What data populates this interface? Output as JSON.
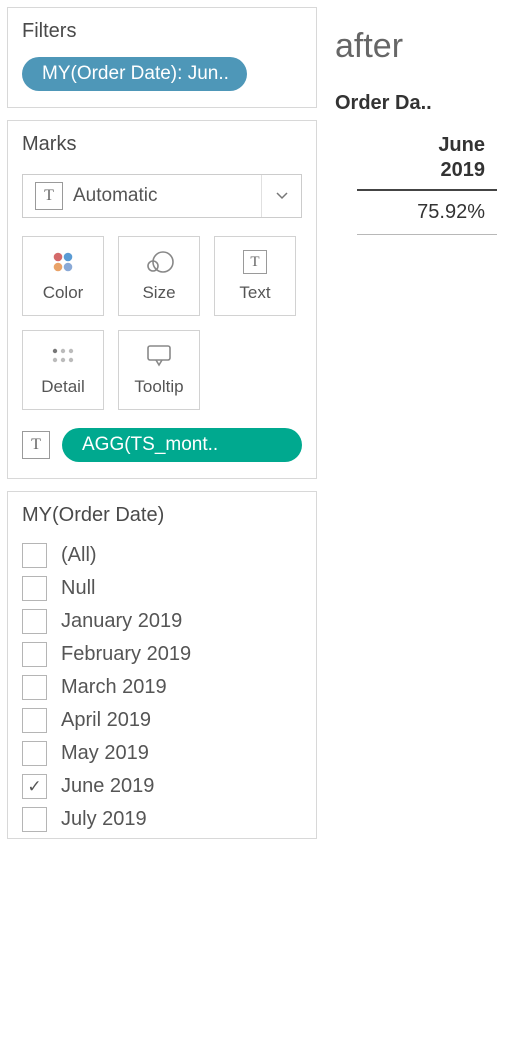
{
  "filters": {
    "title": "Filters",
    "pill_label": "MY(Order Date): Jun.."
  },
  "marks": {
    "title": "Marks",
    "marktype_label": "Automatic",
    "shelves": {
      "color": "Color",
      "size": "Size",
      "text": "Text",
      "detail": "Detail",
      "tooltip": "Tooltip"
    },
    "agg_pill": "AGG(TS_mont.."
  },
  "filter_panel": {
    "title": "MY(Order Date)",
    "items": [
      {
        "label": "(All)",
        "checked": false
      },
      {
        "label": "Null",
        "checked": false
      },
      {
        "label": "January 2019",
        "checked": false
      },
      {
        "label": "February 2019",
        "checked": false
      },
      {
        "label": "March 2019",
        "checked": false
      },
      {
        "label": "April 2019",
        "checked": false
      },
      {
        "label": "May 2019",
        "checked": false
      },
      {
        "label": "June 2019",
        "checked": true
      },
      {
        "label": "July 2019",
        "checked": false
      }
    ]
  },
  "sheet": {
    "title": "after",
    "column_field": "Order Da..",
    "column_value_line1": "June",
    "column_value_line2": "2019",
    "cell_value": "75.92%"
  }
}
